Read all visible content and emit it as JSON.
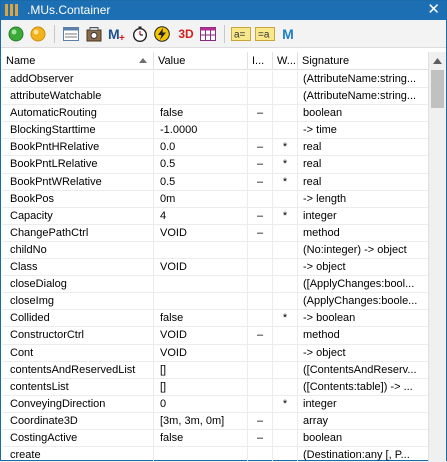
{
  "window": {
    "title": ".MUs.Container",
    "close_glyph": "✕"
  },
  "toolbar": {
    "buttons": [
      {
        "name": "green-light-icon"
      },
      {
        "name": "orange-light-icon"
      },
      {
        "name": "table-view-icon"
      },
      {
        "name": "camera-icon"
      },
      {
        "name": "m-plus-icon",
        "text": "M"
      },
      {
        "name": "stopwatch-icon"
      },
      {
        "name": "lightning-icon"
      },
      {
        "name": "3d-button",
        "text": "3D"
      },
      {
        "name": "grid-icon"
      },
      {
        "name": "a-equals-icon",
        "text": "a="
      },
      {
        "name": "equals-a-icon",
        "text": "=a"
      },
      {
        "name": "m-icon",
        "text": "M"
      }
    ]
  },
  "columns": {
    "name": "Name",
    "value": "Value",
    "i": "I...",
    "w": "W...",
    "signature": "Signature"
  },
  "rows": [
    {
      "name": "addObserver",
      "value": "",
      "i": "",
      "w": "",
      "sig": "(AttributeName:string..."
    },
    {
      "name": "attributeWatchable",
      "value": "",
      "i": "",
      "w": "",
      "sig": "(AttributeName:string..."
    },
    {
      "name": "AutomaticRouting",
      "value": "false",
      "i": "–",
      "w": "",
      "sig": "boolean"
    },
    {
      "name": "BlockingStarttime",
      "value": "-1.0000",
      "i": "",
      "w": "",
      "sig": "-> time"
    },
    {
      "name": "BookPntHRelative",
      "value": "0.0",
      "i": "–",
      "w": "*",
      "sig": "real"
    },
    {
      "name": "BookPntLRelative",
      "value": "0.5",
      "i": "–",
      "w": "*",
      "sig": "real"
    },
    {
      "name": "BookPntWRelative",
      "value": "0.5",
      "i": "–",
      "w": "*",
      "sig": "real"
    },
    {
      "name": "BookPos",
      "value": "0m",
      "i": "",
      "w": "",
      "sig": "-> length"
    },
    {
      "name": "Capacity",
      "value": "4",
      "i": "–",
      "w": "*",
      "sig": "integer"
    },
    {
      "name": "ChangePathCtrl",
      "value": "VOID",
      "i": "–",
      "w": "",
      "sig": "method"
    },
    {
      "name": "childNo",
      "value": "",
      "i": "",
      "w": "",
      "sig": "(No:integer) -> object"
    },
    {
      "name": "Class",
      "value": "VOID",
      "i": "",
      "w": "",
      "sig": "-> object"
    },
    {
      "name": "closeDialog",
      "value": "",
      "i": "",
      "w": "",
      "sig": "([ApplyChanges:bool..."
    },
    {
      "name": "closeImg",
      "value": "",
      "i": "",
      "w": "",
      "sig": "(ApplyChanges:boole..."
    },
    {
      "name": "Collided",
      "value": "false",
      "i": "",
      "w": "*",
      "sig": "-> boolean"
    },
    {
      "name": "ConstructorCtrl",
      "value": "VOID",
      "i": "–",
      "w": "",
      "sig": "method"
    },
    {
      "name": "Cont",
      "value": "VOID",
      "i": "",
      "w": "",
      "sig": "-> object"
    },
    {
      "name": "contentsAndReservedList",
      "value": "[]",
      "i": "",
      "w": "",
      "sig": "([ContentsAndReserv..."
    },
    {
      "name": "contentsList",
      "value": "[]",
      "i": "",
      "w": "",
      "sig": "([Contents:table]) -> ..."
    },
    {
      "name": "ConveyingDirection",
      "value": "0",
      "i": "",
      "w": "*",
      "sig": "integer"
    },
    {
      "name": "Coordinate3D",
      "value": "[3m, 3m, 0m]",
      "i": "–",
      "w": "",
      "sig": "array"
    },
    {
      "name": "CostingActive",
      "value": "false",
      "i": "–",
      "w": "",
      "sig": "boolean"
    },
    {
      "name": "create",
      "value": "",
      "i": "",
      "w": "",
      "sig": "(Destination:any [, P..."
    }
  ]
}
